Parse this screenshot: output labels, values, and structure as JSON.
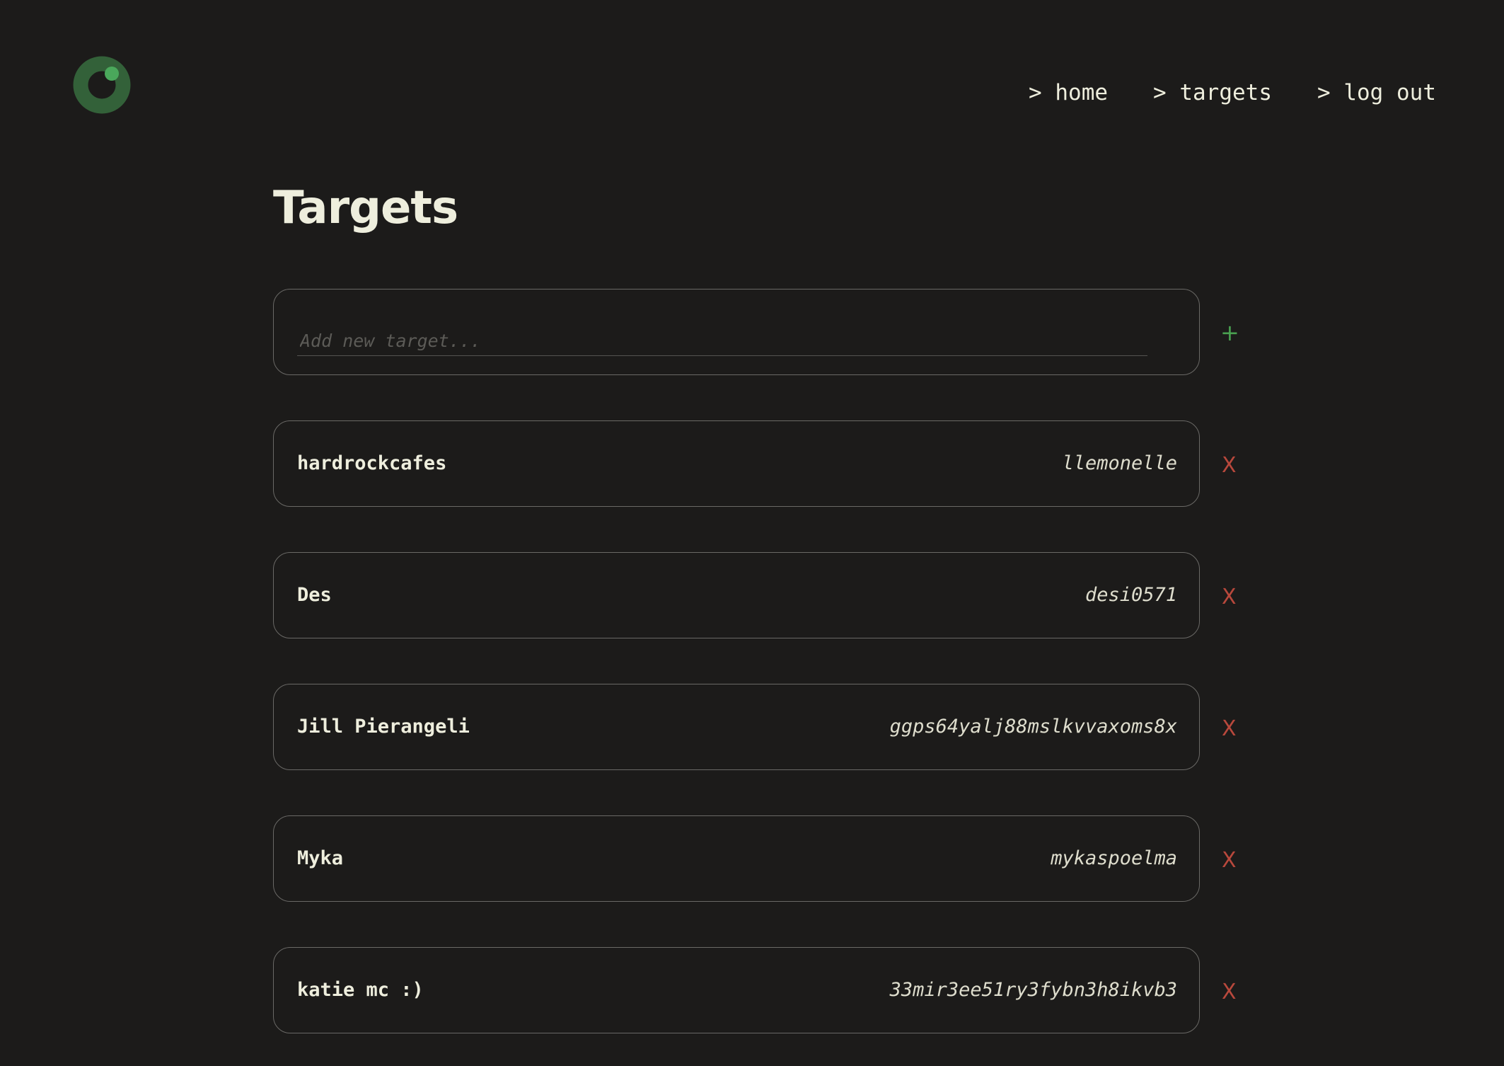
{
  "colors": {
    "background": "#1c1b1a",
    "text": "#eeeedd",
    "logo_ring": "#336139",
    "logo_dot": "#4aa85b",
    "add_accent": "#49a150",
    "delete_accent": "#b8483c",
    "card_border": "#6a6966"
  },
  "logo": {
    "icon": "eye-ring-logo"
  },
  "nav": {
    "items": [
      {
        "label": "> home"
      },
      {
        "label": "> targets"
      },
      {
        "label": "> log out"
      }
    ]
  },
  "page": {
    "title": "Targets"
  },
  "add_target": {
    "placeholder": "Add new target...",
    "value": "",
    "button_label": "+"
  },
  "targets": [
    {
      "name": "hardrockcafes",
      "handle": "llemonelle",
      "delete_label": "X"
    },
    {
      "name": "Des",
      "handle": "desi0571",
      "delete_label": "X"
    },
    {
      "name": "Jill Pierangeli",
      "handle": "ggps64yalj88mslkvvaxoms8x",
      "delete_label": "X"
    },
    {
      "name": "Myka",
      "handle": "mykaspoelma",
      "delete_label": "X"
    },
    {
      "name": "katie mc :)",
      "handle": "33mir3ee51ry3fybn3h8ikvb3",
      "delete_label": "X"
    }
  ]
}
